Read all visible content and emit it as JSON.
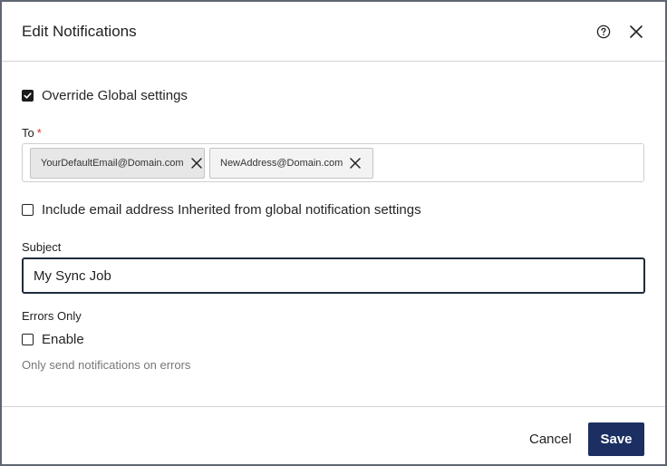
{
  "dialog": {
    "title": "Edit Notifications",
    "help_icon": "help-circle-icon",
    "close_icon": "close-icon"
  },
  "override": {
    "label": "Override Global settings",
    "checked": true
  },
  "to": {
    "label": "To",
    "required_mark": "*",
    "recipients": [
      {
        "email": "YourDefaultEmail@Domain.com"
      },
      {
        "email": "NewAddress@Domain.com"
      }
    ]
  },
  "include_inherited": {
    "label": "Include email address Inherited from global notification settings",
    "checked": false
  },
  "subject": {
    "label": "Subject",
    "value": "My Sync Job"
  },
  "errors_only": {
    "label": "Errors Only",
    "checkbox_label": "Enable",
    "checked": false,
    "hint": "Only send notifications on errors"
  },
  "footer": {
    "cancel_label": "Cancel",
    "save_label": "Save"
  },
  "colors": {
    "primary": "#1b2f63",
    "required": "#d93025",
    "input_focus_border": "#1f2b3d"
  }
}
